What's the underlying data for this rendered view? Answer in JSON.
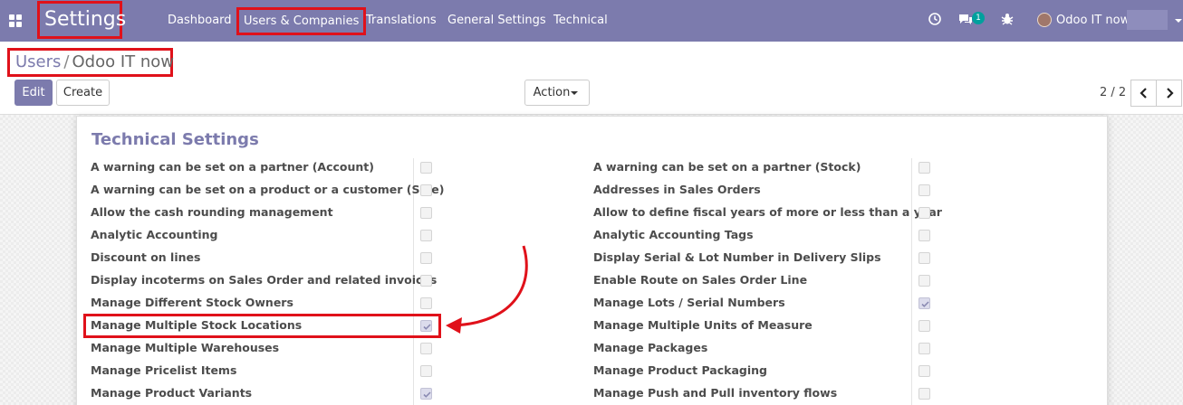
{
  "navbar": {
    "brand": "Settings",
    "menu": [
      "Dashboard",
      "Users & Companies",
      "Translations",
      "General Settings",
      "Technical"
    ],
    "messages_badge": "1",
    "user_name": "Odoo IT now"
  },
  "breadcrumb": {
    "parent": "Users",
    "separator": "/",
    "current": "Odoo IT now"
  },
  "toolbar": {
    "edit_label": "Edit",
    "create_label": "Create",
    "action_label": "Action",
    "pager": "2 / 2"
  },
  "section": {
    "title": "Technical Settings",
    "left": [
      {
        "label": "A warning can be set on a partner (Account)",
        "checked": false
      },
      {
        "label": "A warning can be set on a product or a customer (Sale)",
        "checked": false
      },
      {
        "label": "Allow the cash rounding management",
        "checked": false
      },
      {
        "label": "Analytic Accounting",
        "checked": false
      },
      {
        "label": "Discount on lines",
        "checked": false
      },
      {
        "label": "Display incoterms on Sales Order and related invoices",
        "checked": false
      },
      {
        "label": "Manage Different Stock Owners",
        "checked": false
      },
      {
        "label": "Manage Multiple Stock Locations",
        "checked": true
      },
      {
        "label": "Manage Multiple Warehouses",
        "checked": false
      },
      {
        "label": "Manage Pricelist Items",
        "checked": false
      },
      {
        "label": "Manage Product Variants",
        "checked": true
      }
    ],
    "right": [
      {
        "label": "A warning can be set on a partner (Stock)",
        "checked": false
      },
      {
        "label": "Addresses in Sales Orders",
        "checked": false
      },
      {
        "label": "Allow to define fiscal years of more or less than a year",
        "checked": false
      },
      {
        "label": "Analytic Accounting Tags",
        "checked": false
      },
      {
        "label": "Display Serial & Lot Number in Delivery Slips",
        "checked": false
      },
      {
        "label": "Enable Route on Sales Order Line",
        "checked": false
      },
      {
        "label": "Manage Lots / Serial Numbers",
        "checked": true
      },
      {
        "label": "Manage Multiple Units of Measure",
        "checked": false
      },
      {
        "label": "Manage Packages",
        "checked": false
      },
      {
        "label": "Manage Product Packaging",
        "checked": false
      },
      {
        "label": "Manage Push and Pull inventory flows",
        "checked": false
      }
    ]
  },
  "colors": {
    "brand": "#7c7bad",
    "highlight": "#e0111a",
    "badge": "#00a09d"
  },
  "icons": [
    "apps-grid-icon",
    "clock-icon",
    "chat-icon",
    "bug-icon",
    "chevron-left-icon",
    "chevron-right-icon",
    "checkmark-icon"
  ]
}
